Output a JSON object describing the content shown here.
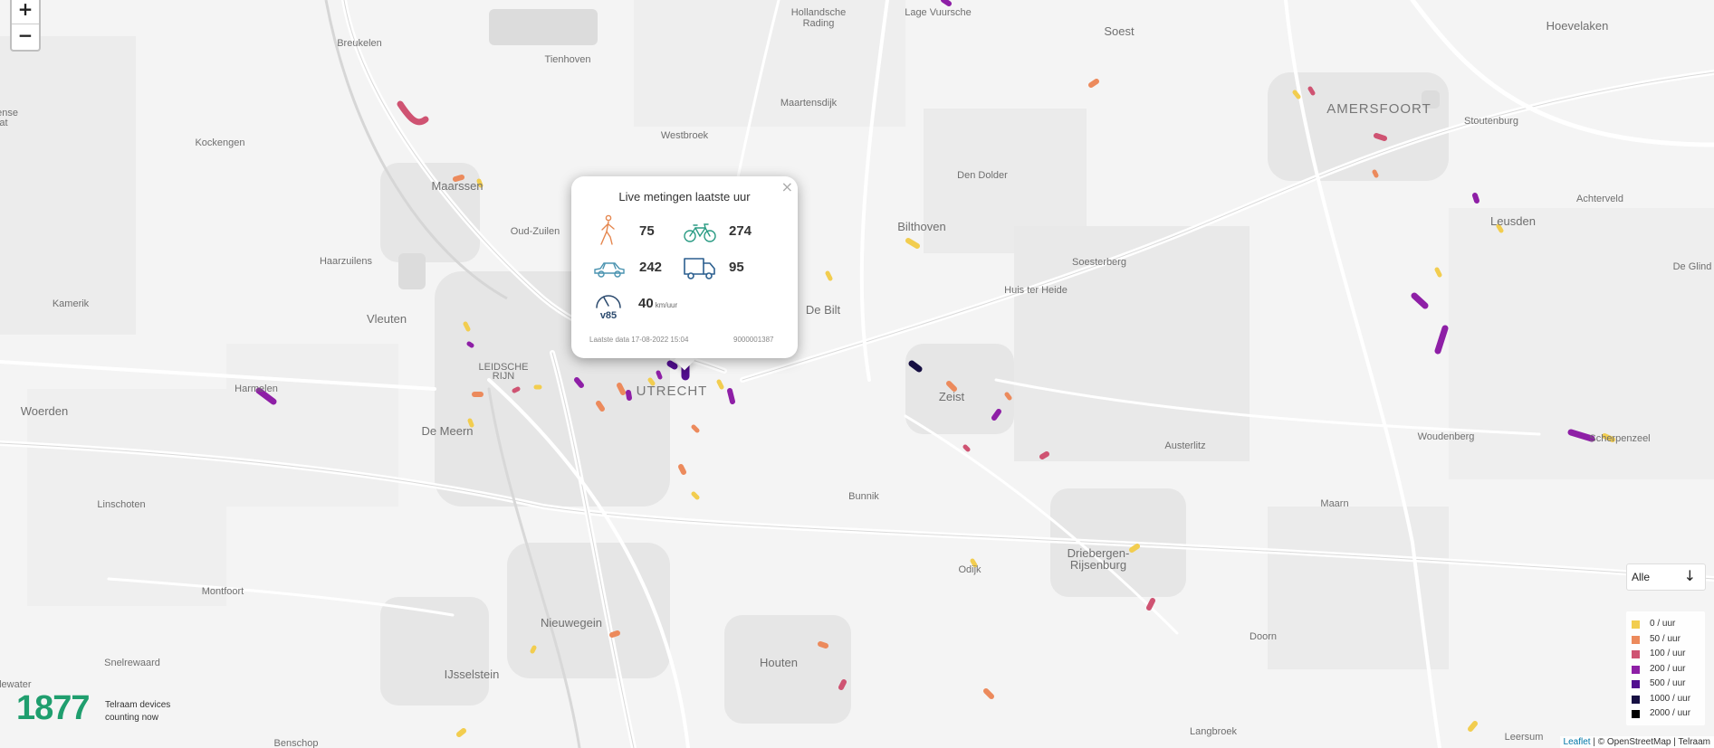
{
  "zoom": {
    "in_label": "+",
    "out_label": "−"
  },
  "places": [
    {
      "id": "hollandsche-1",
      "label": "Hollandsche",
      "cls": ""
    },
    {
      "id": "hollandsche-2",
      "label": "Rading",
      "cls": ""
    },
    {
      "id": "lage-vuursche",
      "label": "Lage Vuursche",
      "cls": ""
    },
    {
      "id": "soest",
      "label": "Soest",
      "cls": "big"
    },
    {
      "id": "hoevelaken",
      "label": "Hoevelaken",
      "cls": "big"
    },
    {
      "id": "breukelen",
      "label": "Breukelen",
      "cls": ""
    },
    {
      "id": "tienhoven",
      "label": "Tienhoven",
      "cls": ""
    },
    {
      "id": "maartensdijk",
      "label": "Maartensdijk",
      "cls": ""
    },
    {
      "id": "amersfoort",
      "label": "AMERSFOORT",
      "cls": "city"
    },
    {
      "id": "stoutenburg",
      "label": "Stoutenburg",
      "cls": ""
    },
    {
      "id": "kockengen",
      "label": "Kockengen",
      "cls": ""
    },
    {
      "id": "westbroek",
      "label": "Westbroek",
      "cls": ""
    },
    {
      "id": "den-dolder",
      "label": "Den Dolder",
      "cls": ""
    },
    {
      "id": "maarssen",
      "label": "Maarssen",
      "cls": "big"
    },
    {
      "id": "achterveld",
      "label": "Achterveld",
      "cls": ""
    },
    {
      "id": "leusden",
      "label": "Leusden",
      "cls": "big"
    },
    {
      "id": "oud-zuilen",
      "label": "Oud-Zuilen",
      "cls": ""
    },
    {
      "id": "bilthoven",
      "label": "Bilthoven",
      "cls": "big"
    },
    {
      "id": "haarzuilens",
      "label": "Haarzuilens",
      "cls": ""
    },
    {
      "id": "soesterberg",
      "label": "Soesterberg",
      "cls": ""
    },
    {
      "id": "de-glind",
      "label": "De Glind",
      "cls": ""
    },
    {
      "id": "huis-ter-heide",
      "label": "Huis ter Heide",
      "cls": ""
    },
    {
      "id": "kamerik",
      "label": "Kamerik",
      "cls": ""
    },
    {
      "id": "de-bilt",
      "label": "De Bilt",
      "cls": "big"
    },
    {
      "id": "vleuten",
      "label": "Vleuten",
      "cls": "big"
    },
    {
      "id": "leidsche-1",
      "label": "LEIDSCHE",
      "cls": ""
    },
    {
      "id": "leidsche-2",
      "label": "RIJN",
      "cls": ""
    },
    {
      "id": "utrecht",
      "label": "UTRECHT",
      "cls": "city"
    },
    {
      "id": "harmelen",
      "label": "Harmelen",
      "cls": ""
    },
    {
      "id": "zeist",
      "label": "Zeist",
      "cls": "big"
    },
    {
      "id": "woerden",
      "label": "Woerden",
      "cls": "big"
    },
    {
      "id": "de-meern",
      "label": "De Meern",
      "cls": "big"
    },
    {
      "id": "scherpenzeel",
      "label": "Scherpenzeel",
      "cls": ""
    },
    {
      "id": "woudenberg",
      "label": "Woudenberg",
      "cls": ""
    },
    {
      "id": "austerlitz",
      "label": "Austerlitz",
      "cls": ""
    },
    {
      "id": "bunnik",
      "label": "Bunnik",
      "cls": ""
    },
    {
      "id": "linschoten",
      "label": "Linschoten",
      "cls": ""
    },
    {
      "id": "maarn",
      "label": "Maarn",
      "cls": ""
    },
    {
      "id": "driebergen",
      "label": "Driebergen-",
      "cls": "big"
    },
    {
      "id": "rijsenburg",
      "label": "Rijsenburg",
      "cls": "big"
    },
    {
      "id": "odijk",
      "label": "Odijk",
      "cls": ""
    },
    {
      "id": "montfoort",
      "label": "Montfoort",
      "cls": ""
    },
    {
      "id": "nieuwegein",
      "label": "Nieuwegein",
      "cls": "big"
    },
    {
      "id": "doorn",
      "label": "Doorn",
      "cls": ""
    },
    {
      "id": "snelrewaard",
      "label": "Snelrewaard",
      "cls": ""
    },
    {
      "id": "houten",
      "label": "Houten",
      "cls": "big"
    },
    {
      "id": "ijsselstein",
      "label": "IJsselstein",
      "cls": "big"
    },
    {
      "id": "langbroek",
      "label": "Langbroek",
      "cls": ""
    },
    {
      "id": "leersum",
      "label": "Leersum",
      "cls": ""
    },
    {
      "id": "benschop",
      "label": "Benschop",
      "cls": ""
    },
    {
      "id": "ense",
      "label": "ense",
      "cls": ""
    },
    {
      "id": "at",
      "label": "at",
      "cls": ""
    },
    {
      "id": "dewater",
      "label": "dewater",
      "cls": ""
    }
  ],
  "popup": {
    "title": "Live metingen laatste uur",
    "close_label": "×",
    "pedestrians": "75",
    "bikes": "274",
    "cars": "242",
    "heavy": "95",
    "v85_value": "40",
    "v85_unit": "km/uur",
    "v85_icon_label": "v85",
    "last_data": "Laatste data 17-08-2022 15:04",
    "device_id": "9000001387"
  },
  "counter": {
    "count": "1877",
    "text": "Telraam devices counting now"
  },
  "filter": {
    "selected": "Alle"
  },
  "legend": [
    {
      "label": "0 / uur",
      "color": "#f2cd4f"
    },
    {
      "label": "50 / uur",
      "color": "#ec8a5c"
    },
    {
      "label": "100 / uur",
      "color": "#cf5372"
    },
    {
      "label": "200 / uur",
      "color": "#8e1fa6"
    },
    {
      "label": "500 / uur",
      "color": "#520e8f"
    },
    {
      "label": "1000 / uur",
      "color": "#160f42"
    },
    {
      "label": "2000 / uur",
      "color": "#000000"
    }
  ],
  "attribution": {
    "leaflet": "Leaflet",
    "rest": " | © OpenStreetMap | Telraam"
  }
}
